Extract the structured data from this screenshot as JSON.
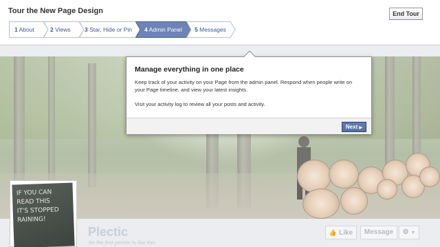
{
  "tour": {
    "title": "Tour the New Page Design",
    "end_label": "End Tour",
    "steps": [
      {
        "num": "1",
        "label": "About",
        "active": false
      },
      {
        "num": "2",
        "label": "Views",
        "active": false
      },
      {
        "num": "3",
        "label": "Star, Hide or Pin",
        "active": false
      },
      {
        "num": "4",
        "label": "Admin Panel",
        "active": true
      },
      {
        "num": "5",
        "label": "Messages",
        "active": false
      }
    ]
  },
  "popup": {
    "title": "Manage everything in one place",
    "paragraph1": "Keep track of your activity on your Page from the admin panel. Respond when people write on your Page timeline, and view your latest insights.",
    "paragraph2": "Visit your activity log to review all your posts and activity.",
    "next_label": "Next"
  },
  "page": {
    "name": "Plectic",
    "subtitle": "Be the first person to like this.",
    "like_label": "Like",
    "message_label": "Message",
    "chalkboard_lines": [
      "IF YOU CAN",
      "READ THIS",
      "IT'S STOPPED",
      "RAINING!"
    ]
  },
  "colors": {
    "link_blue": "#3b5998",
    "active_step": "#6d84b4",
    "next_button": "#5b74a8"
  },
  "icons": {
    "step_arrow": "chevron-step-icon",
    "next_arrow": "triangle-right-icon",
    "like": "thumbs-up-icon",
    "gear": "gear-icon"
  }
}
